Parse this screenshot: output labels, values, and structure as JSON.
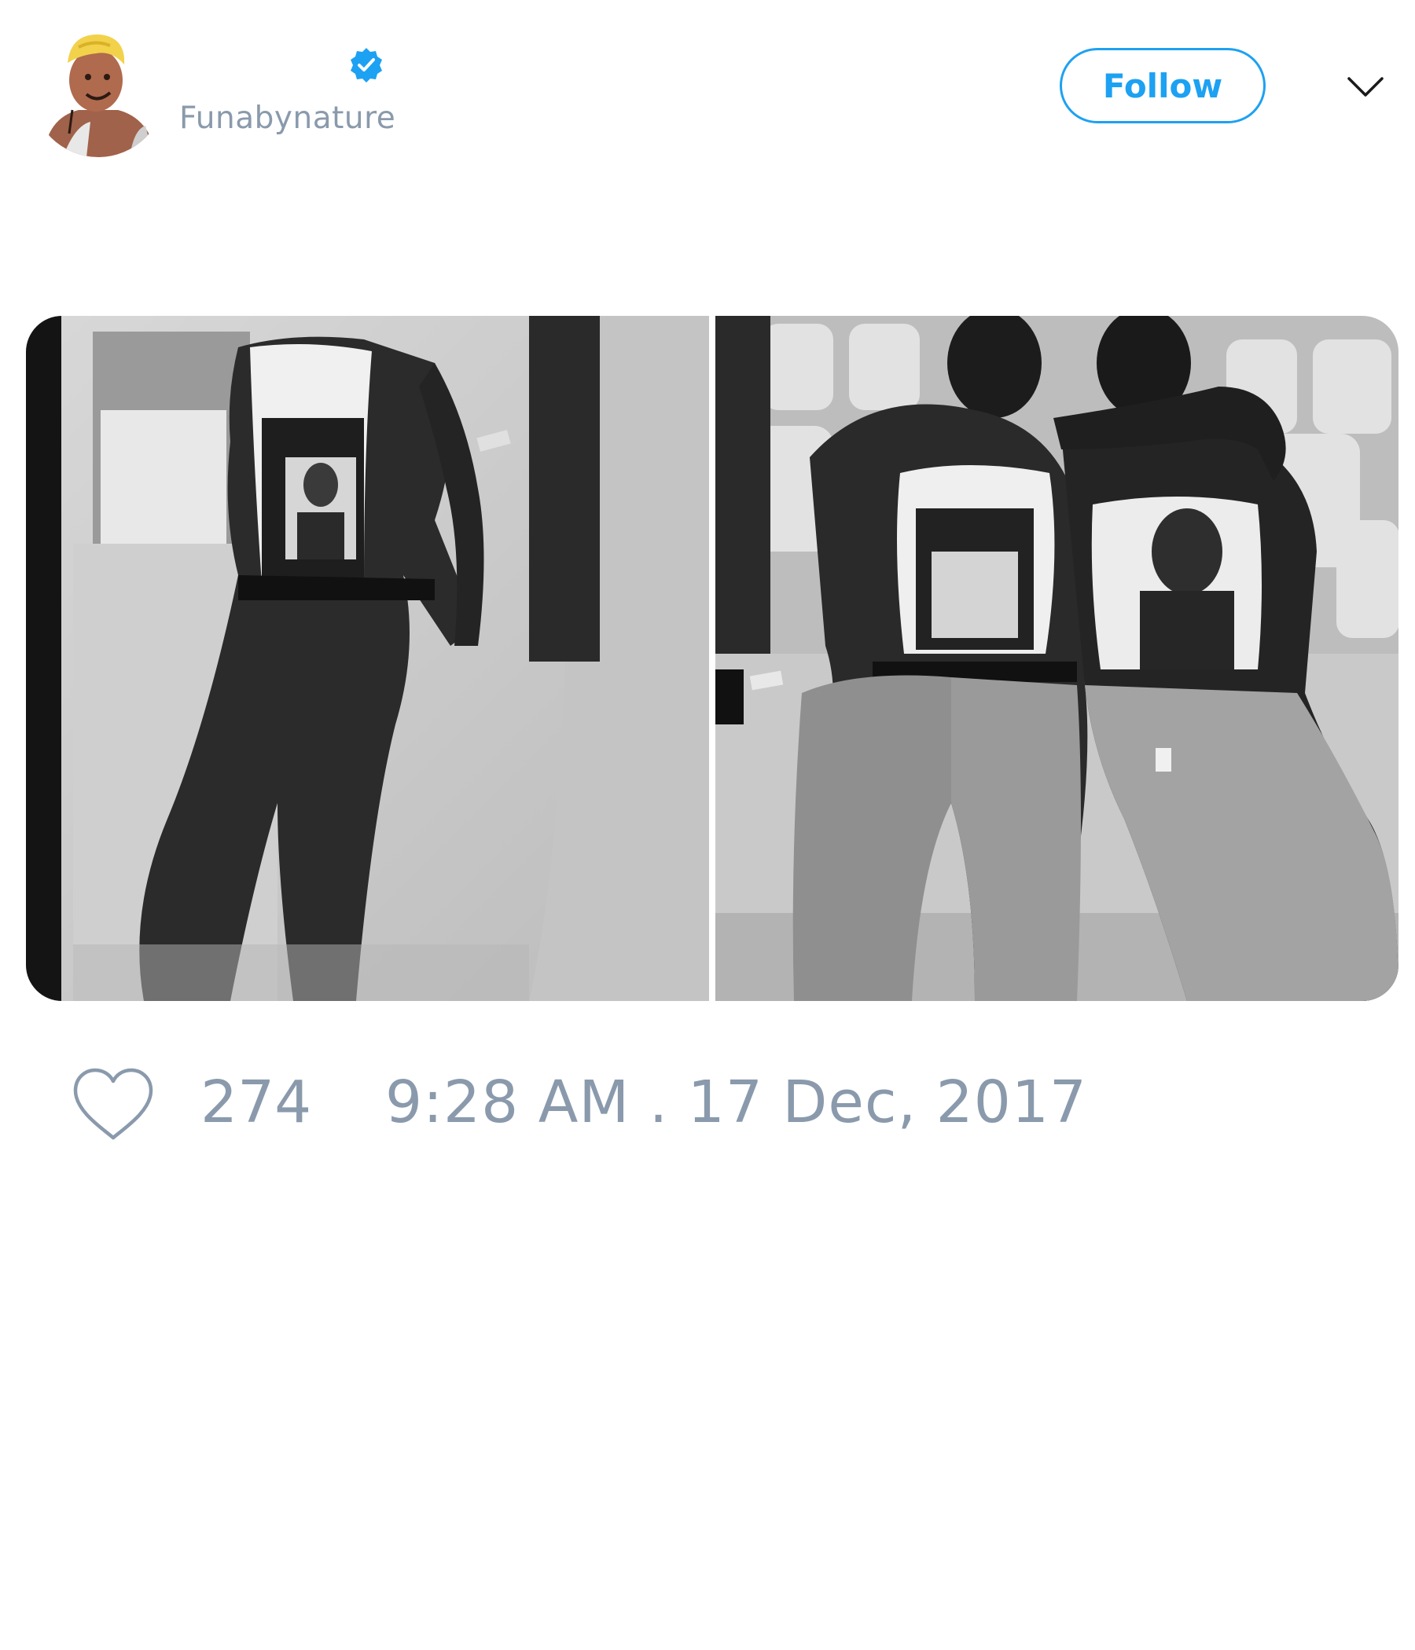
{
  "tweet": {
    "author": {
      "handle": "Funabynature",
      "verified": true,
      "avatar_icon": "cartoon-avatar"
    },
    "follow_label": "Follow",
    "menu_icon": "chevron-down-icon",
    "media": [
      {
        "description_icon": "photo-1"
      },
      {
        "description_icon": "photo-2"
      }
    ],
    "likes": "274",
    "timestamp": "9:28 AM . 17 Dec, 2017"
  },
  "colors": {
    "accent": "#1da1f2",
    "muted_text": "#8a9aac",
    "background": "#ffffff"
  }
}
